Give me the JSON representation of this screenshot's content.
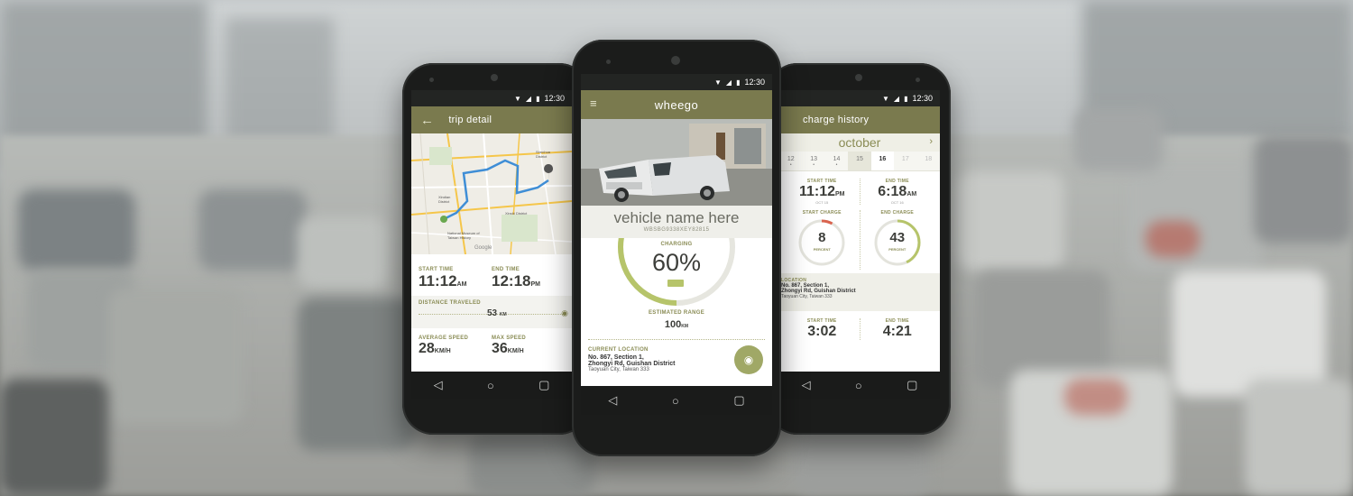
{
  "status_time": "12:30",
  "colors": {
    "accent": "#8a8c55",
    "appbar": "#7a7a4e",
    "ring": "#b6c46a"
  },
  "left_phone": {
    "title": "trip detail",
    "map_labels": [
      "Shenhua District",
      "Xindian District",
      "Xinshi District",
      "National Museum of Taiwan History",
      "Google"
    ],
    "start_time_label": "START TIME",
    "start_time": "11:12",
    "start_ampm": "AM",
    "end_time_label": "END TIME",
    "end_time": "12:18",
    "end_ampm": "PM",
    "distance_label": "DISTANCE TRAVELED",
    "distance_value": "53",
    "distance_unit": "KM",
    "avg_speed_label": "AVERAGE SPEED",
    "avg_speed": "28",
    "speed_unit": "KM/H",
    "max_speed_label": "MAX SPEED",
    "max_speed": "36"
  },
  "center_phone": {
    "brand": "wheego",
    "vehicle_name": "vehicle name here",
    "vin": "WBSBG9338XEY82815",
    "charging_label": "CHARGING",
    "charge_percent": "60%",
    "charge_value": 0.6,
    "range_label": "ESTIMATED RANGE",
    "range_value": "100",
    "range_unit": "KM",
    "location_label": "CURRENT LOCATION",
    "address_line1": "No. 867, Section 1,",
    "address_line2": "Zhongyi Rd, Guishan District",
    "address_line3": "Taoyuan City, Taiwan 333"
  },
  "right_phone": {
    "title": "charge history",
    "month": "october",
    "days": [
      "12",
      "13",
      "14",
      "15",
      "16",
      "17",
      "18"
    ],
    "selected_day": "16",
    "start_time_label": "START TIME",
    "start_time": "11:12",
    "start_ampm": "PM",
    "start_date": "OCT 15",
    "end_time_label": "END TIME",
    "end_time": "6:18",
    "end_ampm": "AM",
    "end_date": "OCT 16",
    "start_charge_label": "START CHARGE",
    "start_charge": "8",
    "start_charge_value": 0.08,
    "end_charge_label": "END CHARGE",
    "end_charge": "43",
    "end_charge_value": 0.43,
    "percent_label": "PERCENT",
    "location_label": "LOCATION",
    "address_line1": "No. 867, Section 1,",
    "address_line2": "Zhongyi Rd, Guishan District",
    "address_line3": "Taoyuan City, Taiwan 333",
    "start_time2_label": "START TIME",
    "start_time2": "3:02",
    "end_time2_label": "END TIME",
    "end_time2": "4:21"
  }
}
